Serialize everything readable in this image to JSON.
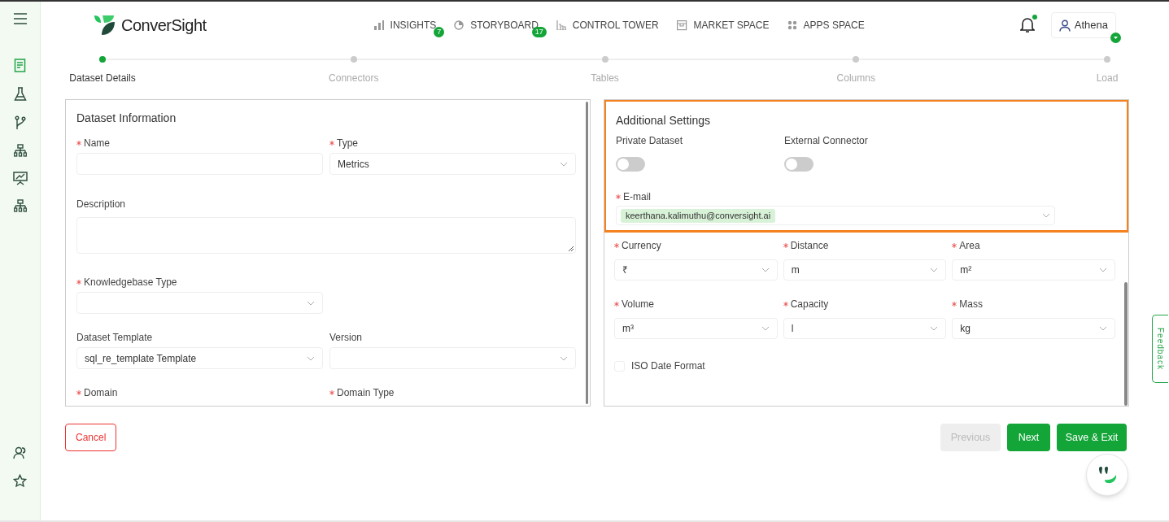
{
  "header": {
    "brand": "ConverSight",
    "nav": [
      {
        "label": "INSIGHTS",
        "badge": "7"
      },
      {
        "label": "STORYBOARD",
        "badge": "17"
      },
      {
        "label": "CONTROL TOWER"
      },
      {
        "label": "MARKET SPACE"
      },
      {
        "label": "APPS SPACE"
      }
    ],
    "notifications": {
      "unread": true
    },
    "user": {
      "name": "Athena"
    }
  },
  "stepper": [
    {
      "label": "Dataset Details",
      "selected": true
    },
    {
      "label": "Connectors",
      "selected": false
    },
    {
      "label": "Tables",
      "selected": false
    },
    {
      "label": "Columns",
      "selected": false
    },
    {
      "label": "Load",
      "selected": false
    }
  ],
  "dataset_information": {
    "title": "Dataset Information",
    "rows": [
      [
        {
          "label": "Name",
          "required": true,
          "kind": "text"
        },
        {
          "label": "Type",
          "required": true,
          "kind": "select",
          "value": "Metrics"
        }
      ],
      [
        {
          "label": "Description",
          "required": false,
          "kind": "textarea"
        }
      ],
      [
        {
          "label": "Knowledgebase Type",
          "required": true,
          "kind": "select"
        }
      ],
      [
        {
          "label": "Dataset Template",
          "required": false,
          "kind": "select",
          "value": "sql_re_template Template"
        },
        {
          "label": "Version",
          "required": false,
          "kind": "select"
        }
      ],
      [
        {
          "label": "Domain",
          "required": true,
          "kind": "label"
        },
        {
          "label": "Domain Type",
          "required": true,
          "kind": "label"
        }
      ]
    ]
  },
  "additional_settings": {
    "title": "Additional Settings",
    "highlighted": true,
    "toggles": [
      {
        "label": "Private Dataset",
        "on": false
      },
      {
        "label": "External Connector",
        "on": false
      }
    ],
    "email": {
      "label": "E-mail",
      "required": true,
      "chips": [
        "keerthana.kalimuthu@conversight.ai"
      ]
    },
    "units": [
      {
        "label": "Currency",
        "required": true,
        "value": "₹"
      },
      {
        "label": "Distance",
        "required": true,
        "value": "m"
      },
      {
        "label": "Area",
        "required": true,
        "value": "m²"
      },
      {
        "label": "Volume",
        "required": true,
        "value": "m³"
      },
      {
        "label": "Capacity",
        "required": true,
        "value": "l"
      },
      {
        "label": "Mass",
        "required": true,
        "value": "kg"
      }
    ],
    "iso_date_format": {
      "label": "ISO Date Format",
      "checked": false
    }
  },
  "buttons": {
    "cancel": {
      "label": "Cancel"
    },
    "previous": {
      "label": "Previous",
      "disabled": true
    },
    "next": {
      "label": "Next",
      "disabled": false
    },
    "save_exit": {
      "label": "Save & Exit",
      "disabled": false
    }
  },
  "feedback": {
    "label": "Feedback"
  }
}
